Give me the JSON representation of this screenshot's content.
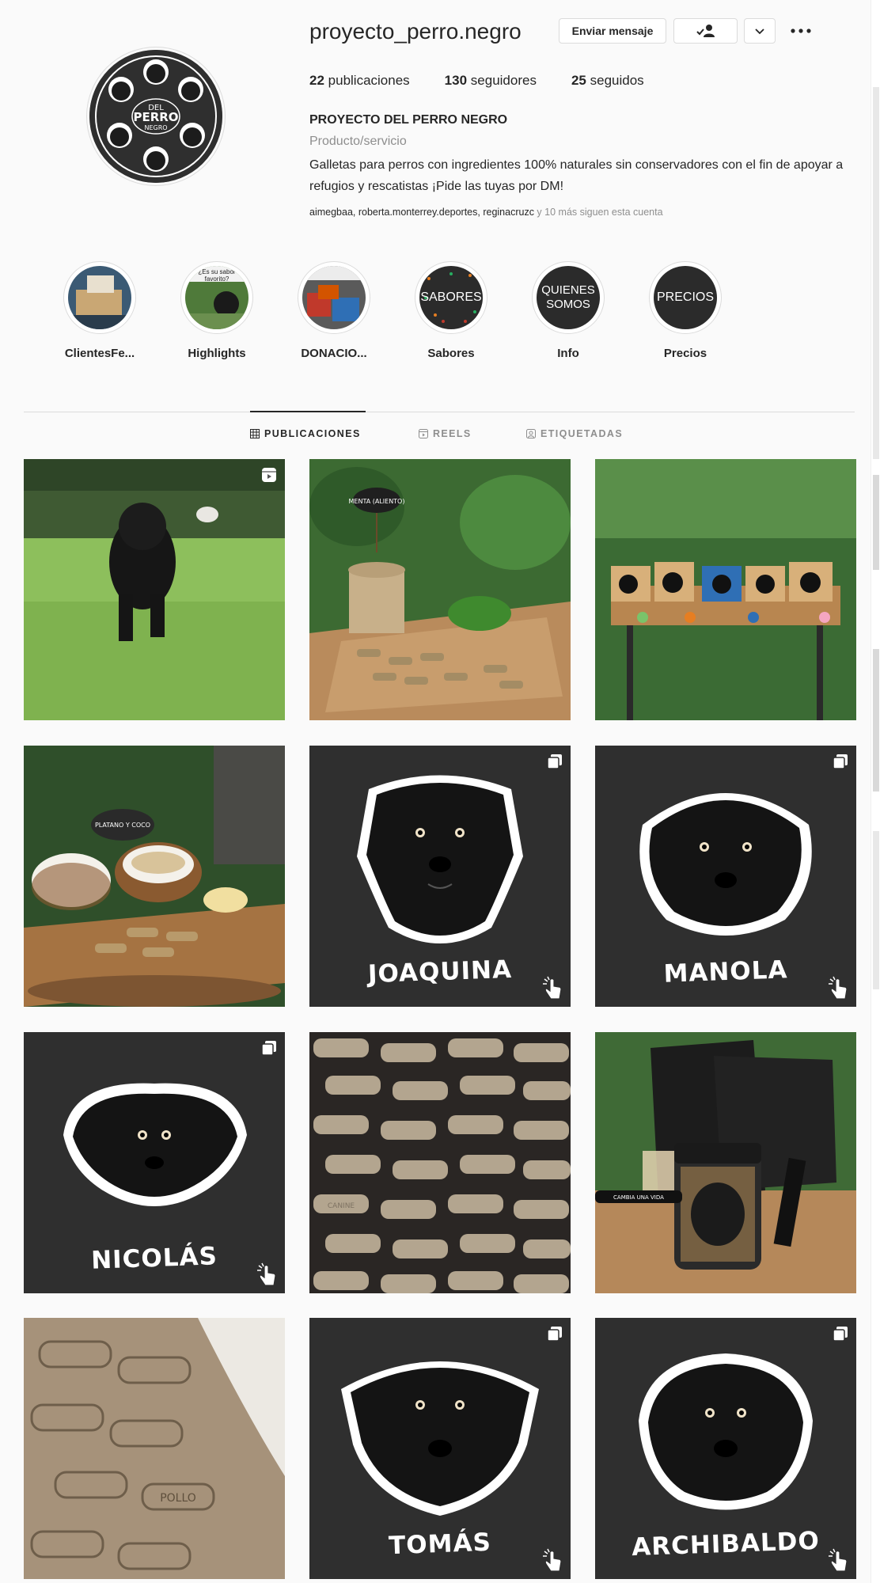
{
  "profile": {
    "username": "proyecto_perro.negro",
    "buttons": {
      "message": "Enviar mensaje"
    },
    "stats": [
      {
        "count": "22",
        "label": "publicaciones"
      },
      {
        "count": "130",
        "label": "seguidores"
      },
      {
        "count": "25",
        "label": "seguidos"
      }
    ],
    "full_name": "PROYECTO DEL PERRO NEGRO",
    "category": "Producto/servicio",
    "bio": "Galletas para perros con ingredientes 100% naturales sin conservadores con el fin de apoyar a refugios y rescatistas ¡Pide las tuyas por DM!",
    "followed_by_names": "aimegbaa, roberta.monterrey.deportes, reginacruzc",
    "followed_by_rest": " y 10 más siguen esta cuenta",
    "avatar_text": [
      "DEL",
      "PERRO",
      "NEGRO"
    ]
  },
  "highlights": [
    {
      "label": "ClientesFe...",
      "icon": "photo-thumbnail"
    },
    {
      "label": "Highlights",
      "icon": "photo-thumbnail",
      "image_text": "¿Es su sabor favorito?"
    },
    {
      "label": "DONACIO...",
      "icon": "photo-thumbnail"
    },
    {
      "label": "Sabores",
      "image_text": "SABORES"
    },
    {
      "label": "Info",
      "image_text": "QUIENES SOMOS"
    },
    {
      "label": "Precios",
      "image_text": "PRECIOS"
    }
  ],
  "tabs": [
    {
      "label": "PUBLICACIONES",
      "icon": "grid-icon",
      "active": true
    },
    {
      "label": "REELS",
      "icon": "reels-icon",
      "active": false
    },
    {
      "label": "ETIQUETADAS",
      "icon": "tagged-icon",
      "active": false
    }
  ],
  "posts": [
    {
      "type": "photo",
      "subject": "black dog on lawn",
      "badge": "reel-icon"
    },
    {
      "type": "photo",
      "subject": "biscuits with mint",
      "sign": "MENTA (ALIENTO)"
    },
    {
      "type": "photo",
      "subject": "plush dogs in boxes"
    },
    {
      "type": "photo",
      "subject": "coconut biscuits",
      "sign": "PLATANO Y COCO"
    },
    {
      "type": "illustration",
      "name": "JOAQUINA",
      "badge": "carousel-icon"
    },
    {
      "type": "illustration",
      "name": "MANOLA",
      "badge": "carousel-icon"
    },
    {
      "type": "illustration",
      "name": "NICOLÁS",
      "badge": "carousel-icon"
    },
    {
      "type": "photo",
      "subject": "bone-shaped biscuits tray",
      "imprint": "CANINE"
    },
    {
      "type": "photo",
      "subject": "packaging and jar",
      "jar_text": "CAMBIA UNA VIDA"
    },
    {
      "type": "photo",
      "subject": "dough with bone cutouts",
      "imprint": "POLLO"
    },
    {
      "type": "illustration",
      "name": "TOMÁS",
      "badge": "carousel-icon"
    },
    {
      "type": "illustration",
      "name": "ARCHIBALDO",
      "badge": "carousel-icon"
    }
  ],
  "colors": {
    "dark_tile": "#2f2f2f",
    "muted": "#8e8e8e",
    "border": "#dbdbdb"
  }
}
